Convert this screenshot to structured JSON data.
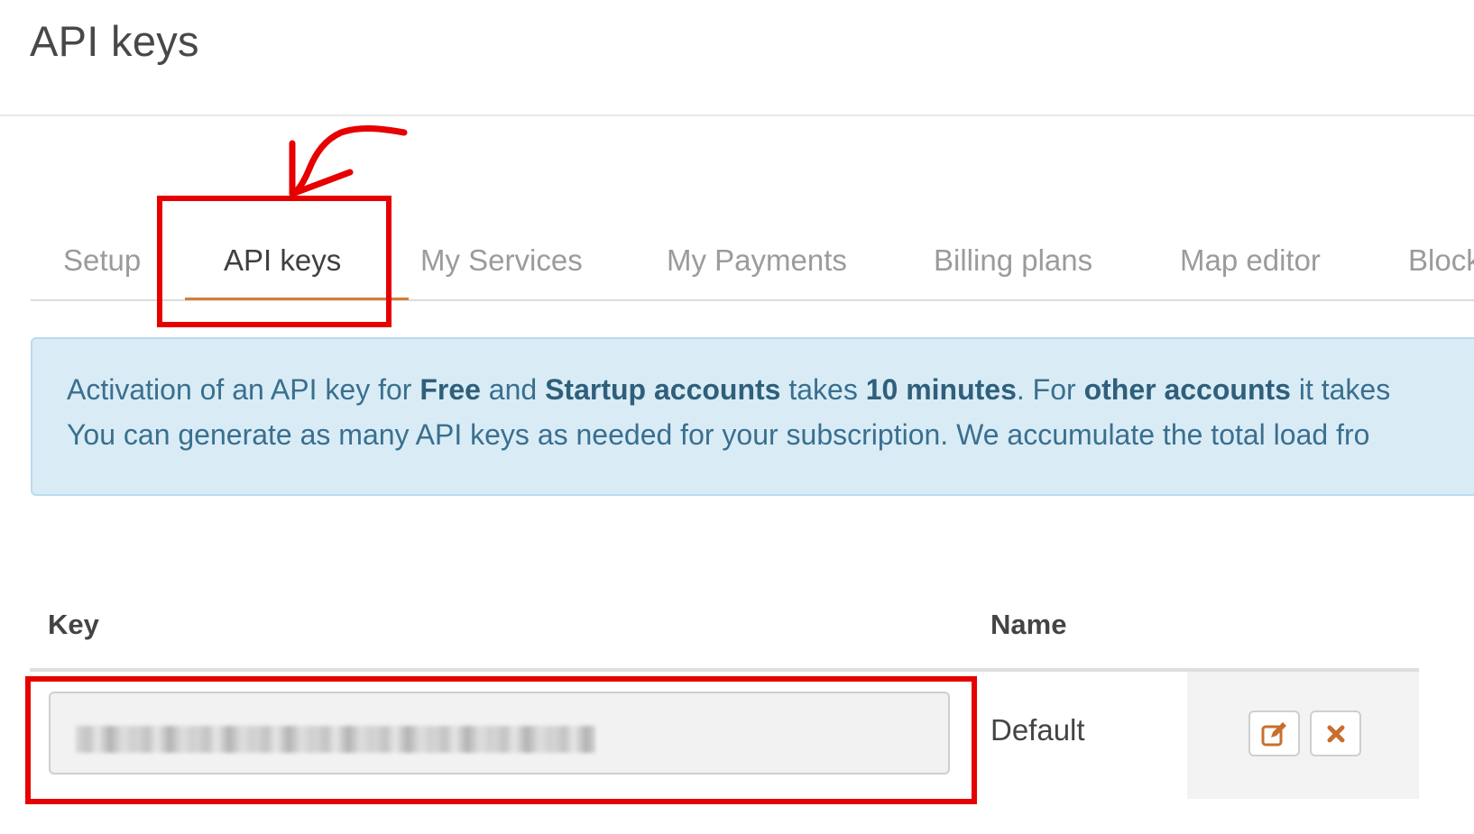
{
  "page": {
    "title": "API keys"
  },
  "tabs": [
    {
      "label": "Setup",
      "active": false
    },
    {
      "label": "API keys",
      "active": true
    },
    {
      "label": "My Services",
      "active": false
    },
    {
      "label": "My Payments",
      "active": false
    },
    {
      "label": "Billing plans",
      "active": false
    },
    {
      "label": "Map editor",
      "active": false
    },
    {
      "label": "Block",
      "active": false
    }
  ],
  "alert": {
    "line1": {
      "t1": "Activation of an API key for ",
      "b1": "Free",
      "t2": " and ",
      "b2": "Startup accounts",
      "t3": " takes ",
      "b3": "10 minutes",
      "t4": ". For ",
      "b4": "other accounts",
      "t5": " it takes"
    },
    "line2": "You can generate as many API keys as needed for your subscription. We accumulate the total load fro"
  },
  "table": {
    "headers": {
      "key": "Key",
      "name": "Name"
    },
    "rows": [
      {
        "key_value": "",
        "name": "Default",
        "actions": [
          "edit-icon",
          "delete-icon"
        ]
      }
    ]
  },
  "colors": {
    "accent": "#d27d3c",
    "alert_bg": "#d9ecf6",
    "alert_text": "#3a6f8e",
    "annotation": "#e60000"
  }
}
